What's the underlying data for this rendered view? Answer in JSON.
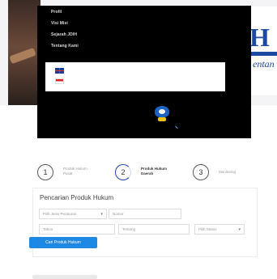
{
  "menu": {
    "items": [
      "Profil",
      "Visi Misi",
      "Sejarah JDIH",
      "Tentang Kami"
    ]
  },
  "languages": [
    {
      "icon": "uk-flag-icon"
    },
    {
      "icon": "indonesia-flag-icon"
    }
  ],
  "hero": {
    "logo_letter": "H",
    "logo_script": "entan"
  },
  "steps": [
    {
      "number": "1",
      "label_line1": "Produk Hukum",
      "label_line2": "Pusat",
      "active": false
    },
    {
      "number": "2",
      "label_line1": "Produk Hukum",
      "label_line2": "Daerah",
      "active": true
    },
    {
      "number": "3",
      "label_line1": "Monitoring",
      "label_line2": "",
      "active": false
    }
  ],
  "search": {
    "title": "Pencarian Produk Hukum",
    "type_placeholder": "Pilih Jenis Peraturan",
    "number_placeholder": "Nomor",
    "year_placeholder": "Tahun",
    "about_placeholder": "Tentang",
    "status_placeholder": "Pilih Status",
    "button_label": "Cari Produk Hukum"
  },
  "colors": {
    "menu_bg": "#000000",
    "accent": "#1e88e5",
    "step_active": "#1d3fae",
    "logo_blue": "#1c4aa0"
  }
}
